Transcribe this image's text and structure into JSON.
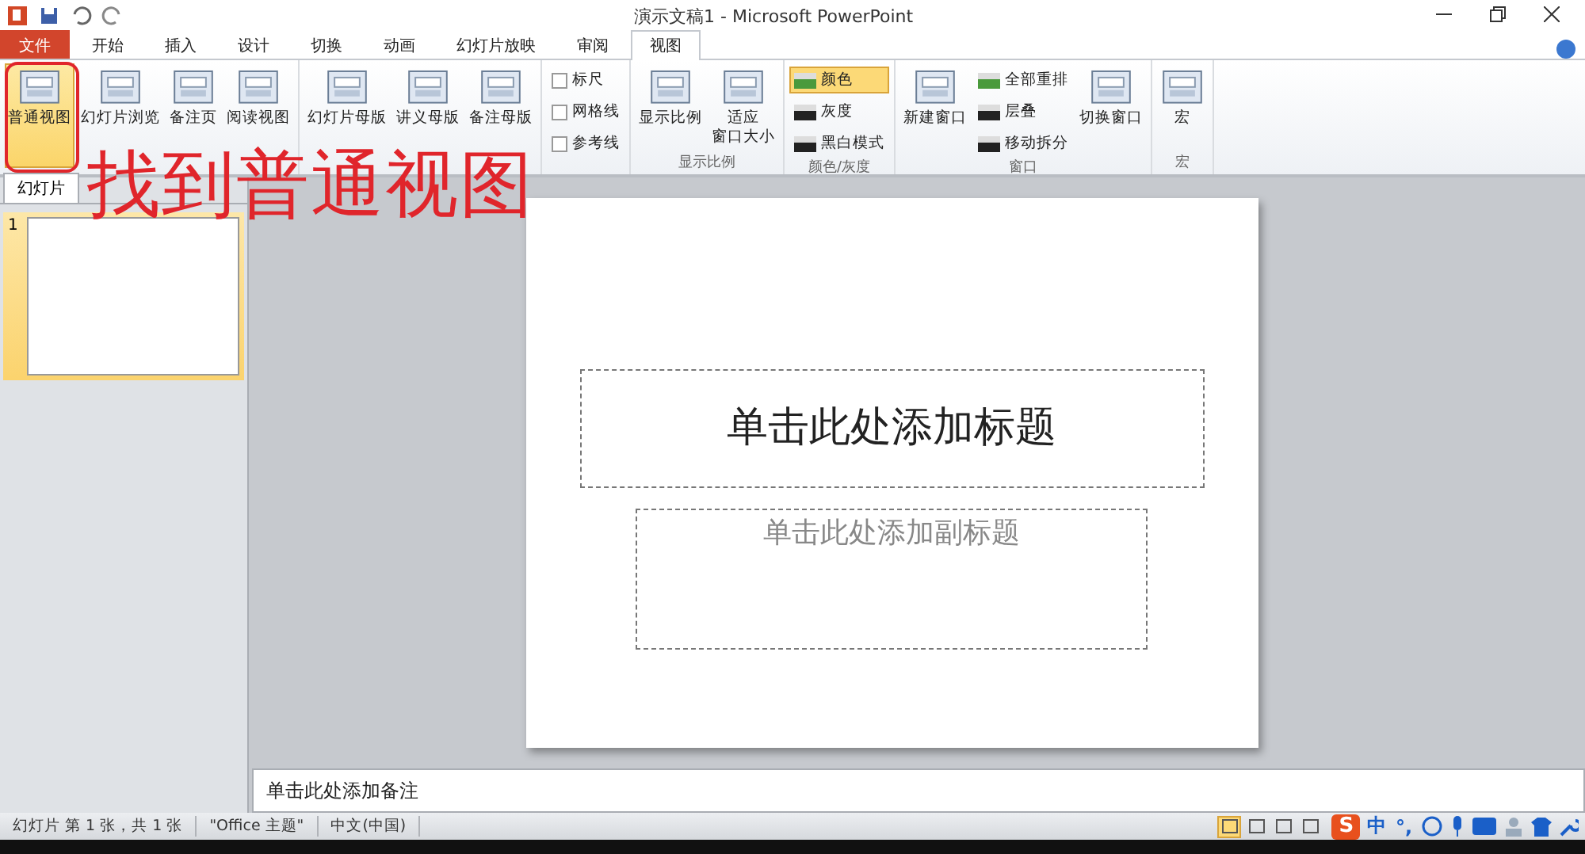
{
  "window": {
    "title": "演示文稿1 - Microsoft PowerPoint"
  },
  "tabs": [
    {
      "label": "文件",
      "kind": "file",
      "selected": false
    },
    {
      "label": "开始",
      "kind": "tab",
      "selected": false
    },
    {
      "label": "插入",
      "kind": "tab",
      "selected": false
    },
    {
      "label": "设计",
      "kind": "tab",
      "selected": false
    },
    {
      "label": "切换",
      "kind": "tab",
      "selected": false
    },
    {
      "label": "动画",
      "kind": "tab",
      "selected": false
    },
    {
      "label": "幻灯片放映",
      "kind": "tab",
      "selected": false
    },
    {
      "label": "审阅",
      "kind": "tab",
      "selected": false
    },
    {
      "label": "视图",
      "kind": "tab",
      "selected": true
    }
  ],
  "ribbon": {
    "groups": [
      {
        "items": [
          {
            "kind": "large",
            "label": "普通视图",
            "selected": true
          },
          {
            "kind": "large",
            "label": "幻灯片浏览",
            "selected": false
          },
          {
            "kind": "large",
            "label": "备注页",
            "selected": false
          },
          {
            "kind": "large",
            "label": "阅读视图",
            "selected": false
          }
        ]
      },
      {
        "items": [
          {
            "kind": "large",
            "label": "幻灯片母版",
            "selected": false
          },
          {
            "kind": "large",
            "label": "讲义母版",
            "selected": false
          },
          {
            "kind": "large",
            "label": "备注母版",
            "selected": false
          }
        ]
      },
      {
        "items": [
          {
            "kind": "check",
            "label": "标尺",
            "checked": false
          },
          {
            "kind": "check",
            "label": "网格线",
            "checked": false
          },
          {
            "kind": "check",
            "label": "参考线",
            "checked": false
          }
        ]
      },
      {
        "label": "显示比例",
        "items": [
          {
            "kind": "large",
            "label": "显示比例",
            "selected": false
          },
          {
            "kind": "large",
            "label_lines": [
              "适应",
              "窗口大小"
            ],
            "selected": false
          }
        ]
      },
      {
        "label": "颜色/灰度",
        "items": [
          {
            "kind": "small",
            "label": "颜色",
            "selected": true
          },
          {
            "kind": "small",
            "label": "灰度",
            "selected": false
          },
          {
            "kind": "small",
            "label": "黑白模式",
            "selected": false
          }
        ]
      },
      {
        "label": "窗口",
        "items": [
          {
            "kind": "large",
            "label": "新建窗口",
            "selected": false
          },
          {
            "kind": "small",
            "label": "全部重排",
            "selected": false
          },
          {
            "kind": "small",
            "label": "层叠",
            "selected": false
          },
          {
            "kind": "small",
            "label": "移动拆分",
            "selected": false
          },
          {
            "kind": "large",
            "label": "切换窗口",
            "selected": false
          }
        ]
      },
      {
        "label": "宏",
        "items": [
          {
            "kind": "large",
            "label": "宏",
            "selected": false
          }
        ]
      }
    ]
  },
  "annotation": {
    "text": "找到普通视图"
  },
  "left_panel": {
    "tabs": [
      {
        "label": "幻灯片",
        "selected": true
      }
    ],
    "slides": [
      {
        "number": "1",
        "selected": true
      }
    ]
  },
  "slide": {
    "title_placeholder": "单击此处添加标题",
    "subtitle_placeholder": "单击此处添加副标题"
  },
  "notes": {
    "placeholder": "单击此处添加备注"
  },
  "status_bar": {
    "items": [
      "幻灯片 第 1 张，共 1 张",
      "\"Office 主题\"",
      "中文(中国)"
    ],
    "view_buttons": [
      {
        "selected": true
      },
      {
        "selected": false
      },
      {
        "selected": false
      },
      {
        "selected": false
      }
    ],
    "ime": {
      "logo": "S",
      "mode": "中",
      "punct": "°,"
    }
  }
}
